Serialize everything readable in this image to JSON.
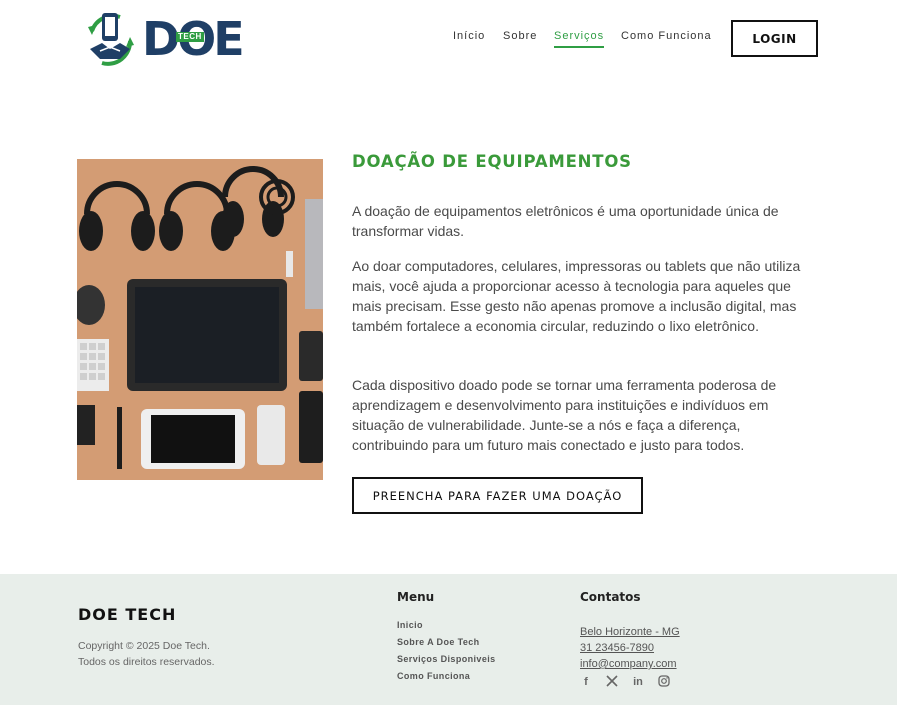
{
  "brand": {
    "logo_text": "DOE",
    "logo_badge": "TECH"
  },
  "nav": {
    "items": [
      "Início",
      "Sobre",
      "Serviços",
      "Como Funciona"
    ],
    "active_index": 2,
    "login_label": "LOGIN"
  },
  "main": {
    "title": "DOAÇÃO DE EQUIPAMENTOS",
    "paragraphs": [
      "A doação de equipamentos eletrônicos é uma oportunidade única de transformar vidas.",
      "Ao doar computadores, celulares, impressoras ou tablets que não utiliza mais, você ajuda a proporcionar acesso à tecnologia para aqueles que mais precisam. Esse gesto não apenas promove a inclusão digital, mas também fortalece a economia circular, reduzindo o lixo eletrônico.",
      "Cada dispositivo doado pode se tornar uma ferramenta poderosa de aprendizagem e desenvolvimento para instituições e indivíduos em situação de vulnerabilidade. Junte-se a nós e faça a diferença, contribuindo para um futuro mais conectado e justo para todos."
    ],
    "cta_label": "PREENCHA PARA FAZER UMA DOAÇÃO"
  },
  "footer": {
    "brand": "DOE TECH",
    "copyright_line1": "Copyright © 2025 Doe Tech.",
    "copyright_line2": "Todos os direitos reservados.",
    "menu_heading": "Menu",
    "menu_items": [
      "Inicio",
      "Sobre A Doe Tech",
      "Serviços Disponiveis",
      "Como Funciona"
    ],
    "contacts_heading": "Contatos",
    "contacts": [
      "Belo Horizonte - MG",
      "31 23456-7890",
      "info@company.com"
    ],
    "social": [
      {
        "icon": "facebook-icon",
        "glyph": "f"
      },
      {
        "icon": "x-icon",
        "glyph": "𝕏"
      },
      {
        "icon": "linkedin-icon",
        "glyph": "in"
      },
      {
        "icon": "instagram-icon",
        "glyph": ""
      }
    ]
  },
  "colors": {
    "accent": "#3a9a3a",
    "brand_navy": "#1f3f66",
    "footer_bg": "#e8eeea"
  }
}
